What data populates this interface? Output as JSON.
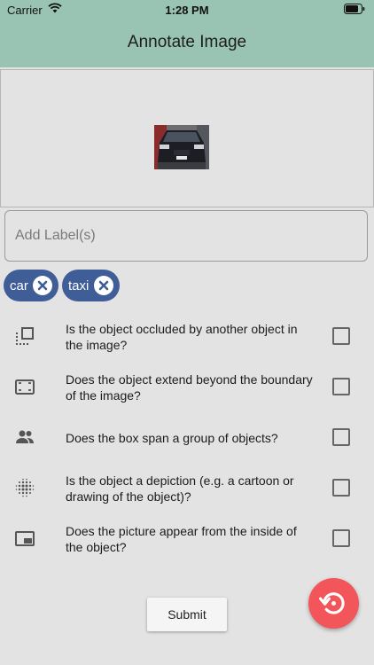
{
  "status_bar": {
    "carrier": "Carrier",
    "time": "1:28 PM"
  },
  "nav": {
    "title": "Annotate Image"
  },
  "label_input": {
    "placeholder": "Add Label(s)",
    "value": ""
  },
  "tags": [
    {
      "label": "car"
    },
    {
      "label": "taxi"
    }
  ],
  "questions": [
    {
      "text": "Is the object occluded by another object in the image?",
      "icon": "occluded-icon",
      "checked": false
    },
    {
      "text": "Does the object extend beyond the boundary of the image?",
      "icon": "crop-frame-icon",
      "checked": false
    },
    {
      "text": "Does the box span a group of objects?",
      "icon": "group-people-icon",
      "checked": false
    },
    {
      "text": "Is the object a depiction (e.g. a cartoon or drawing of the object)?",
      "icon": "dots-pattern-icon",
      "checked": false
    },
    {
      "text": "Does the picture appear from the inside of the object?",
      "icon": "picture-in-picture-icon",
      "checked": false
    }
  ],
  "submit": {
    "label": "Submit"
  },
  "colors": {
    "header": "#99c4b4",
    "chip": "#3f5d96",
    "fab": "#f2555a",
    "background": "#e3e3e3"
  }
}
